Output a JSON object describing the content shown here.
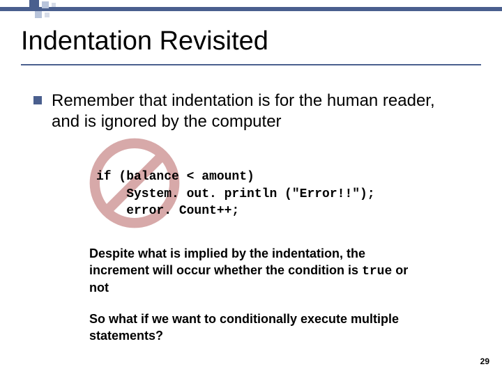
{
  "title": "Indentation Revisited",
  "bullet": "Remember that indentation is for the human reader, and is ignored by the computer",
  "code": {
    "line1": "if (balance < amount)",
    "line2": "    System. out. println (\"Error!!\");",
    "line3": "    error. Count++;"
  },
  "para1_a": "Despite what is implied by the indentation, the increment will occur whether the condition is ",
  "para1_true": "true",
  "para1_b": " or not",
  "para2": "So what if we want to conditionally execute multiple statements?",
  "page_number": "29"
}
